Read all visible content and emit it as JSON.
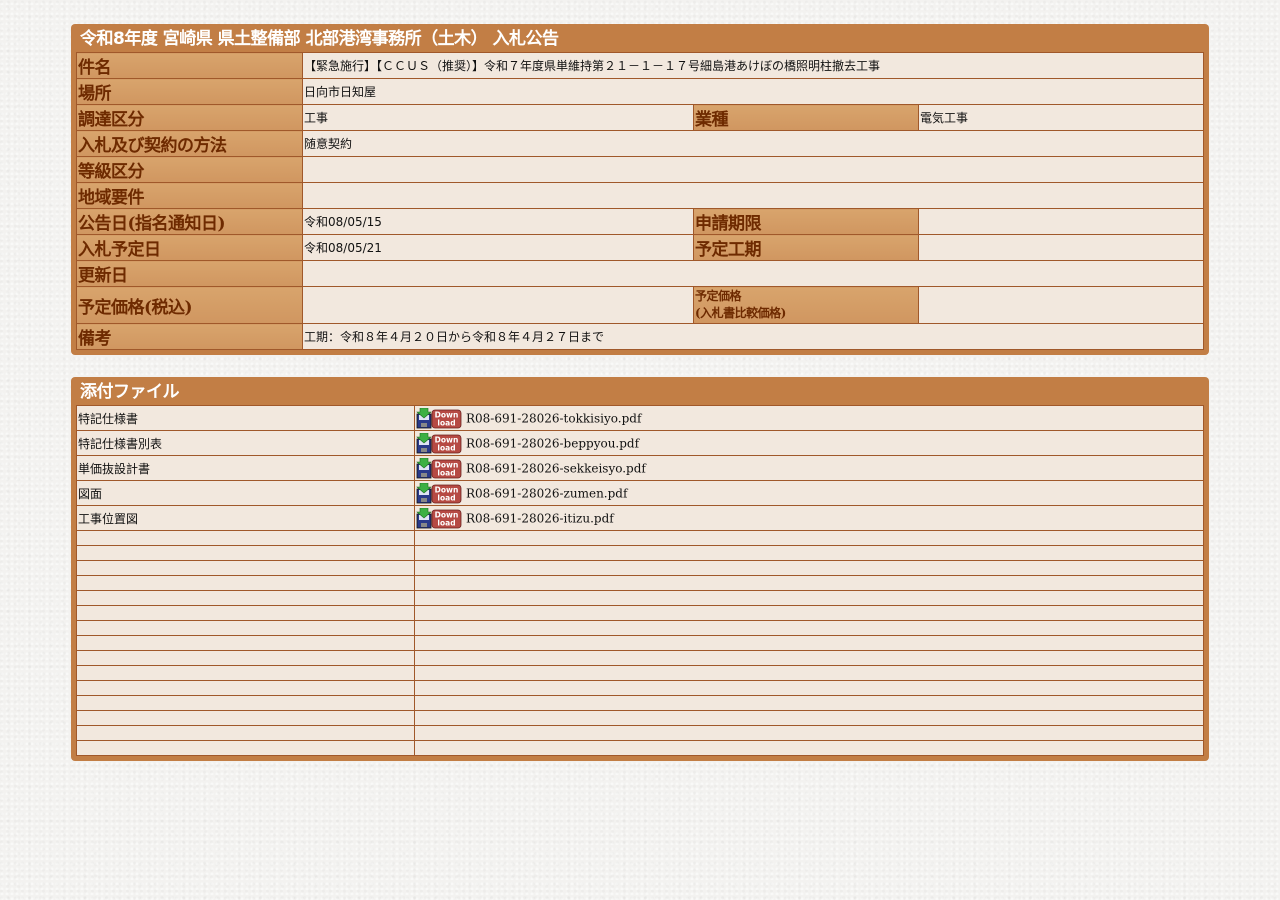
{
  "notice": {
    "title": "令和8年度 宮崎県 県土整備部 北部港湾事務所（土木） 入札公告",
    "labels": {
      "subject": "件名",
      "place": "場所",
      "procurement_type": "調達区分",
      "industry": "業種",
      "bid_method": "入札及び契約の方法",
      "grade": "等級区分",
      "region_req": "地域要件",
      "announce_date": "公告日(指名通知日)",
      "apply_deadline": "申請期限",
      "bid_date": "入札予定日",
      "work_period": "予定工期",
      "update_date": "更新日",
      "planned_price": "予定価格(税込)",
      "planned_price2_line1": "予定価格",
      "planned_price2_line2": "(入札書比較価格)",
      "remarks": "備考"
    },
    "values": {
      "subject": "【緊急施行】【ＣＣＵＳ（推奨）】令和７年度県単維持第２１－１－１７号細島港あけぼの橋照明柱撤去工事",
      "place": "日向市日知屋",
      "procurement_type": "工事",
      "industry": "電気工事",
      "bid_method": "随意契約",
      "grade": "",
      "region_req": "",
      "announce_date": "令和08/05/15",
      "apply_deadline": "",
      "bid_date": "令和08/05/21",
      "work_period": "",
      "update_date": "",
      "planned_price": "",
      "planned_price2": "",
      "remarks": "工期：令和８年４月２０日から令和８年４月２７日まで"
    }
  },
  "attachments": {
    "title": "添付ファイル",
    "files": [
      {
        "name": "特記仕様書",
        "file": "R08-691-28026-tokkisiyo.pdf"
      },
      {
        "name": "特記仕様書別表",
        "file": "R08-691-28026-beppyou.pdf"
      },
      {
        "name": "単価抜設計書",
        "file": "R08-691-28026-sekkeisyo.pdf"
      },
      {
        "name": "図面",
        "file": "R08-691-28026-zumen.pdf"
      },
      {
        "name": "工事位置図",
        "file": "R08-691-28026-itizu.pdf"
      }
    ],
    "empty_rows": 15
  },
  "icons": {
    "download": "download-icon"
  },
  "colors": {
    "panel": "#c27e45",
    "label_bg": "#d8a46c",
    "label_text": "#6e2a00"
  }
}
